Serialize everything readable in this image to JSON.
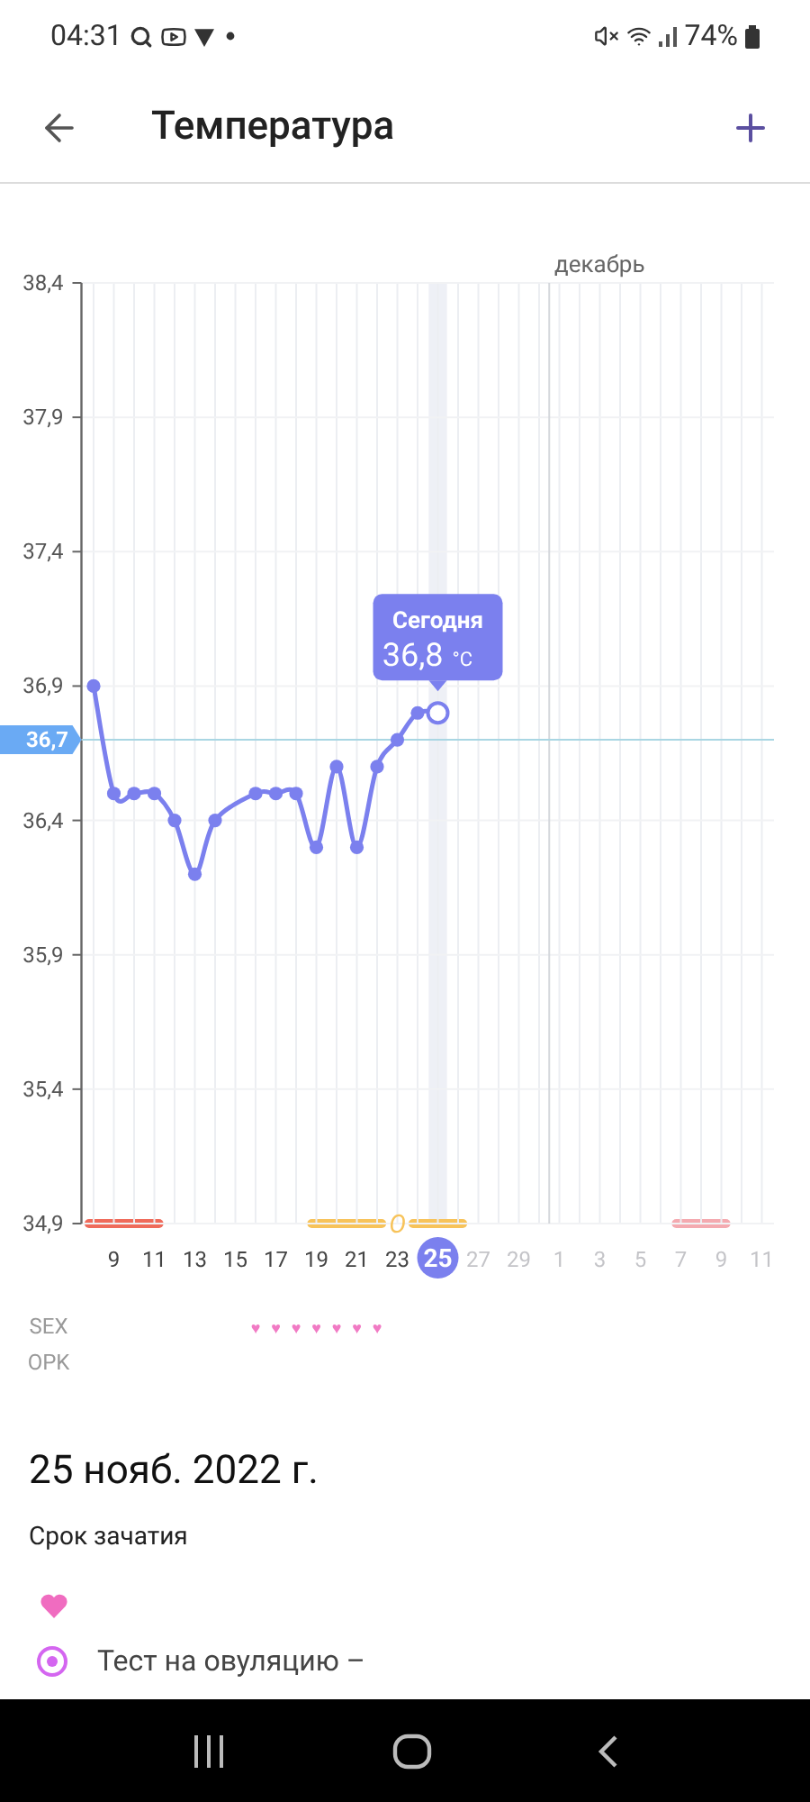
{
  "status_bar": {
    "time": "04:31",
    "battery": "74%"
  },
  "header": {
    "title": "Температура"
  },
  "chart": {
    "chart_data": {
      "type": "line",
      "grid": true,
      "categories": [
        null,
        "9",
        null,
        "11",
        null,
        "13",
        null,
        "15",
        null,
        "17",
        null,
        "19",
        null,
        "21",
        null,
        "23",
        null,
        "25",
        null,
        "27",
        null,
        "29",
        null,
        "1",
        null,
        "3",
        null,
        "5",
        null,
        "7",
        null,
        "9",
        null,
        "11"
      ],
      "ylim": [
        34.9,
        38.4
      ],
      "yticks": [
        {
          "value": 38.4,
          "label": "38,4"
        },
        {
          "value": 37.9,
          "label": "37,9"
        },
        {
          "value": 37.4,
          "label": "37,4"
        },
        {
          "value": 36.9,
          "label": "36,9"
        },
        {
          "value": 36.4,
          "label": "36,4"
        },
        {
          "value": 35.9,
          "label": "35,9"
        },
        {
          "value": 35.4,
          "label": "35,4"
        },
        {
          "value": 34.9,
          "label": "34,9"
        }
      ],
      "series": [
        {
          "color": "#7b80ee",
          "marker": "o",
          "values": [
            36.9,
            36.5,
            36.5,
            36.5,
            36.4,
            36.2,
            36.4,
            null,
            36.5,
            36.5,
            36.5,
            36.3,
            36.6,
            36.3,
            36.6,
            36.7,
            36.8,
            36.8,
            null,
            null,
            null,
            null,
            null,
            null,
            null,
            null,
            null,
            null,
            null,
            null,
            null,
            null,
            null,
            null
          ]
        }
      ],
      "ref_lines": [
        {
          "axis": "y",
          "value": 36.7,
          "label": "36,7",
          "color": "#a9d6e3"
        }
      ]
    },
    "month_label": "декабрь",
    "phase_bars": [
      {
        "color": "#ef6b5b"
      },
      {
        "color": "#f7c35a"
      },
      {
        "color": "#f7c35a"
      },
      {
        "color": "#f4aab0"
      }
    ],
    "ovulation_mark": "O",
    "hearts": [
      "♥",
      "♥",
      "♥",
      "♥",
      "♥",
      "♥",
      "♥"
    ],
    "today_tooltip": {
      "title": "Сегодня",
      "value": "36,8",
      "unit": "°C"
    },
    "rows": [
      "SEX",
      "OPK"
    ]
  },
  "details": {
    "date": "25 нояб. 2022 г.",
    "phase": "Срок зачатия",
    "ovulation_test": "Тест на овуляцию –"
  }
}
